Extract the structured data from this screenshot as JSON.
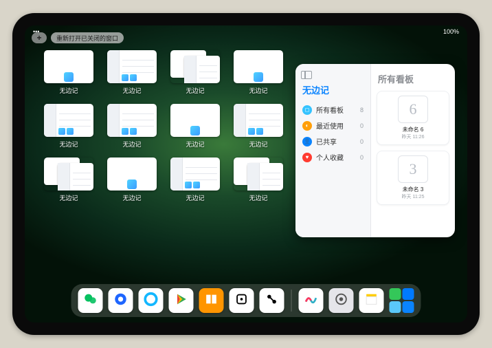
{
  "status": {
    "battery": "100%",
    "signal": "•••"
  },
  "topbar": {
    "plus_label": "+",
    "reopen_label": "重新打开已关闭的窗口"
  },
  "app_name": "无边记",
  "windows": [
    {
      "label": "无边记",
      "kind": "blank"
    },
    {
      "label": "无边记",
      "kind": "cal"
    },
    {
      "label": "无边记",
      "kind": "double"
    },
    {
      "label": "无边记",
      "kind": "blank"
    },
    {
      "label": "无边记",
      "kind": "cal"
    },
    {
      "label": "无边记",
      "kind": "cal"
    },
    {
      "label": "无边记",
      "kind": "blank"
    },
    {
      "label": "无边记",
      "kind": "cal"
    },
    {
      "label": "无边记",
      "kind": "double"
    },
    {
      "label": "无边记",
      "kind": "blank"
    },
    {
      "label": "无边记",
      "kind": "cal"
    },
    {
      "label": "无边记",
      "kind": "double"
    }
  ],
  "large_window": {
    "left_title": "无边记",
    "right_title": "所有看板",
    "items": [
      {
        "icon_color": "#34c3ff",
        "glyph": "◻",
        "label": "所有看板",
        "count": "8"
      },
      {
        "icon_color": "#ff9f0a",
        "glyph": "◐",
        "label": "最近使用",
        "count": "0"
      },
      {
        "icon_color": "#0a84ff",
        "glyph": "👤",
        "label": "已共享",
        "count": "0"
      },
      {
        "icon_color": "#ff3b30",
        "glyph": "♥",
        "label": "个人收藏",
        "count": "0"
      }
    ],
    "cards": [
      {
        "sketch": "6",
        "name": "未命名 6",
        "sub": "昨天 11:26"
      },
      {
        "sketch": "3",
        "name": "未命名 3",
        "sub": "昨天 11:25"
      }
    ]
  },
  "dock": {
    "apps": [
      {
        "name": "wechat",
        "bg": "#ffffff",
        "fg": "#07c160"
      },
      {
        "name": "browser-hd",
        "bg": "#ffffff",
        "fg": "#1e66ff"
      },
      {
        "name": "qq-browser",
        "bg": "#ffffff",
        "fg": "#13b7ff"
      },
      {
        "name": "play",
        "bg": "#ffffff",
        "fg": "#34a853"
      },
      {
        "name": "books",
        "bg": "#ff9500",
        "fg": "#ffffff"
      },
      {
        "name": "dice",
        "bg": "#ffffff",
        "fg": "#000000"
      },
      {
        "name": "connect",
        "bg": "#ffffff",
        "fg": "#000000"
      },
      {
        "name": "freeform",
        "bg": "#ffffff",
        "fg": "#30b0c7"
      },
      {
        "name": "settings",
        "bg": "#e5e5ea",
        "fg": "#555555"
      },
      {
        "name": "notes",
        "bg": "#ffffff",
        "fg": "#ffcc00"
      }
    ],
    "recent_stack": [
      "#34c759",
      "#007aff",
      "#5ac8fa",
      "#0a84ff"
    ]
  },
  "colors": {
    "accent": "#0a84ff"
  }
}
